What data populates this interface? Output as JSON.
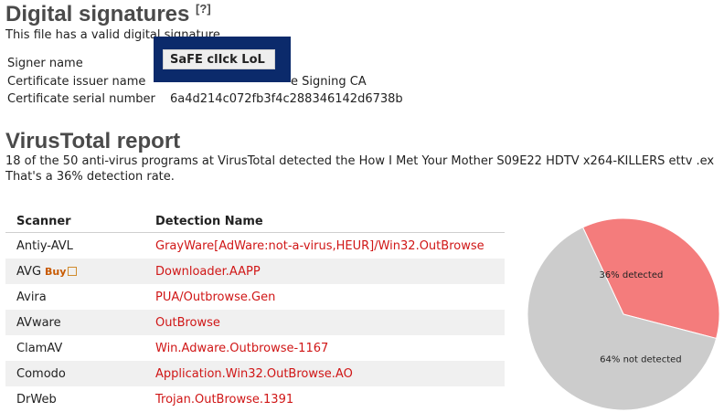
{
  "sig": {
    "title": "Digital signatures",
    "help": "[?]",
    "valid_text": "This file has a valid digital signature",
    "rows": [
      {
        "label": "Signer name",
        "value": ""
      },
      {
        "label": "Certificate issuer name",
        "value": "e Signing CA"
      },
      {
        "label": "Certificate serial number",
        "value": "6a4d214c072fb3f4c288346142d6738b"
      }
    ],
    "overlay_text": "SaFE clIck LoL"
  },
  "vt": {
    "title": "VirusTotal report",
    "line1": "18 of the 50 anti-virus programs at VirusTotal detected the How I Met Your Mother S09E22 HDTV x264-KILLERS ettv .ex",
    "line2": "That's a 36% detection rate.",
    "col_scanner": "Scanner",
    "col_detection": "Detection Name",
    "buy_label": "Buy",
    "rows": [
      {
        "scanner": "Antiy-AVL",
        "detection": "GrayWare[AdWare:not-a-virus,HEUR]/Win32.OutBrowse"
      },
      {
        "scanner": "AVG",
        "detection": "Downloader.AAPP"
      },
      {
        "scanner": "Avira",
        "detection": "PUA/Outbrowse.Gen"
      },
      {
        "scanner": "AVware",
        "detection": "OutBrowse"
      },
      {
        "scanner": "ClamAV",
        "detection": "Win.Adware.Outbrowse-1167"
      },
      {
        "scanner": "Comodo",
        "detection": "Application.Win32.OutBrowse.AO"
      },
      {
        "scanner": "DrWeb",
        "detection": "Trojan.OutBrowse.1391"
      }
    ]
  },
  "chart_data": {
    "type": "pie",
    "categories": [
      "36% detected",
      "64% not detected"
    ],
    "values": [
      36,
      64
    ],
    "colors": [
      "#f47c7c",
      "#cccccc"
    ]
  }
}
